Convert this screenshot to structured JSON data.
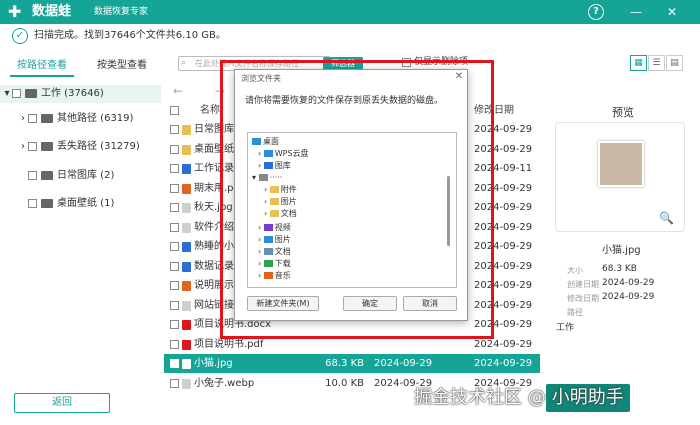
{
  "app": {
    "logo": "✚",
    "title": "数据蛙",
    "subtitle": "数据恢复专家",
    "help_label": "?",
    "minimize_label": "—",
    "close_label": "✕"
  },
  "status": {
    "check_glyph": "✓",
    "text": "扫描完成。找到37646个文件共6.10 GB。"
  },
  "tabs": {
    "by_path": "按路径查看",
    "by_type": "按类型查看"
  },
  "toolbar": {
    "search_placeholder": "在此处输入文件名称保存路径",
    "filter_label": "筛选器",
    "deleted_only": "仅显示删除项",
    "view_grid": "▦",
    "view_list": "☰",
    "view_detail": "▤"
  },
  "tree": {
    "root": {
      "label": "工作 (37646)"
    },
    "items": [
      {
        "label": "其他路径 (6319)",
        "expandable": true
      },
      {
        "label": "丢失路径 (31279)",
        "expandable": true
      },
      {
        "label": "日常图库 (2)",
        "expandable": false
      },
      {
        "label": "桌面壁纸 (1)",
        "expandable": false
      }
    ]
  },
  "file_list": {
    "nav": "← →",
    "columns": {
      "name": "名称",
      "modified": "修改日期"
    },
    "rows": [
      {
        "name": "日常图库",
        "size": "",
        "date": "",
        "date2": "2024-09-29",
        "color": "#e8c053"
      },
      {
        "name": "桌面壁纸",
        "size": "",
        "date": "",
        "date2": "2024-09-29",
        "color": "#e8c053"
      },
      {
        "name": "工作记录1.docx",
        "size": "",
        "date": "",
        "date2": "2024-09-11",
        "color": "#2b6fd6"
      },
      {
        "name": "期末用.pptx",
        "size": "",
        "date": "",
        "date2": "2024-09-29",
        "color": "#e0641c"
      },
      {
        "name": "秋天.jpg",
        "size": "",
        "date": "",
        "date2": "2024-09-29",
        "color": "#cfcfcf"
      },
      {
        "name": "软件介绍.txt",
        "size": "",
        "date": "",
        "date2": "2024-09-29",
        "color": "#cfcfcf"
      },
      {
        "name": "熟睡的小猫.jpg",
        "size": "",
        "date": "",
        "date2": "2024-09-29",
        "color": "#2b6fd6"
      },
      {
        "name": "数据记录表.xlsx",
        "size": "",
        "date": "",
        "date2": "2024-09-29",
        "color": "#2b6fd6"
      },
      {
        "name": "说明展示.pdf",
        "size": "",
        "date": "",
        "date2": "2024-09-29",
        "color": "#e0641c"
      },
      {
        "name": "网站链接.txt",
        "size": "",
        "date": "",
        "date2": "2024-09-29",
        "color": "#cfcfcf"
      },
      {
        "name": "项目说明书.docx",
        "size": "",
        "date": "",
        "date2": "2024-09-29",
        "color": "#e0141c"
      },
      {
        "name": "项目说明书.pdf",
        "size": "",
        "date": "",
        "date2": "2024-09-29",
        "color": "#e0141c"
      },
      {
        "name": "小猫.jpg",
        "size": "68.3 KB",
        "date": "2024-09-29",
        "date2": "2024-09-29",
        "color": "#fff",
        "selected": true
      },
      {
        "name": "小兔子.webp",
        "size": "10.0 KB",
        "date": "2024-09-29",
        "date2": "2024-09-29",
        "color": "#cfcfcf"
      }
    ]
  },
  "preview": {
    "title": "预览",
    "zoom_glyph": "🔍",
    "filename": "小猫.jpg",
    "meta": [
      {
        "key": "大小",
        "value": "68.3 KB"
      },
      {
        "key": "创建日期",
        "value": "2024-09-29"
      },
      {
        "key": "修改日期",
        "value": "2024-09-29"
      },
      {
        "key": "路径",
        "value": "工作"
      }
    ]
  },
  "dialog": {
    "title": "浏览文件夹",
    "close_glyph": "✕",
    "message": "请你将需要恢复的文件保存到原丢失数据的磁盘。",
    "tree": {
      "desktop": "桌面",
      "wps": "WPS云盘",
      "gallery": "图库",
      "user": "·····",
      "attachments": "附件",
      "pictures_sub": "图片",
      "documents_sub": "文档",
      "videos": "视频",
      "pictures": "图片",
      "documents": "文档",
      "downloads": "下载",
      "music": "音乐"
    },
    "buttons": {
      "new_folder": "新建文件夹(M)",
      "ok": "确定",
      "cancel": "取消"
    }
  },
  "footer": {
    "back_label": "返回",
    "watermark_text": "掘金技术社区 @",
    "watermark_badge": "小明助手"
  },
  "colors": {
    "accent": "#15a597",
    "highlight_frame": "#e0141c"
  }
}
